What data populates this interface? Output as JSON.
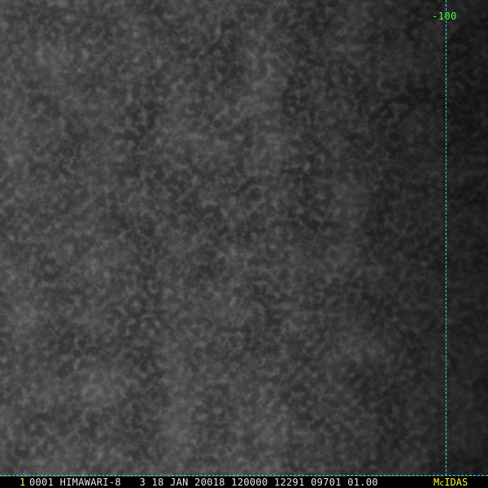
{
  "colors": {
    "grid": "#36d6d6",
    "longitude_label": "#3dff3d",
    "frame_number": "#ffff30",
    "header_text": "#e8e8e8",
    "logo": "#ffff30",
    "background": "#000000"
  },
  "longitude_label": "-100",
  "status_bar": {
    "frame_number": "1",
    "header_text": "0001 HIMAWARI-8   3 18 JAN 20018 120000 12291 09701 01.00"
  },
  "logo": {
    "part1": "M",
    "part2": "c",
    "part3": "IDAS"
  }
}
